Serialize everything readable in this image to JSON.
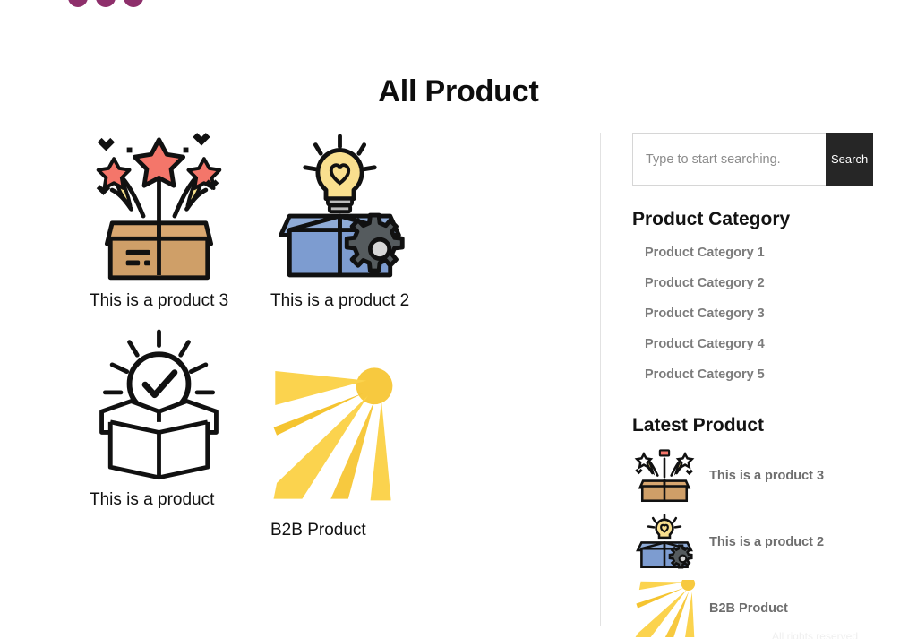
{
  "page": {
    "title": "All Product",
    "footer_text": "All rights reserved"
  },
  "products": [
    {
      "title": "This is a product 3",
      "icon": "gift-box-fireworks-icon"
    },
    {
      "title": "This is a product 2",
      "icon": "blue-box-lightbulb-gear-icon"
    },
    {
      "title": "This is a product",
      "icon": "open-box-checkmark-icon"
    },
    {
      "title": "B2B Product",
      "icon": "sun-rays-icon"
    }
  ],
  "sidebar": {
    "search": {
      "placeholder": "Type to start searching.",
      "value": "",
      "button_label": "Search"
    },
    "category_heading": "Product Category",
    "categories": [
      "Product Category 1",
      "Product Category 2",
      "Product Category 3",
      "Product Category 4",
      "Product Category 5"
    ],
    "latest_heading": "Latest Product",
    "latest": [
      {
        "title": "This is a product 3",
        "icon": "gift-box-fireworks-icon"
      },
      {
        "title": "This is a product 2",
        "icon": "blue-box-lightbulb-gear-icon"
      },
      {
        "title": "B2B Product",
        "icon": "sun-rays-icon"
      }
    ]
  },
  "colors": {
    "search_button_bg": "#262626",
    "category_text": "#7c7c7c",
    "divider": "#e2e2e2",
    "logo_dot": "#8e2f6b"
  }
}
